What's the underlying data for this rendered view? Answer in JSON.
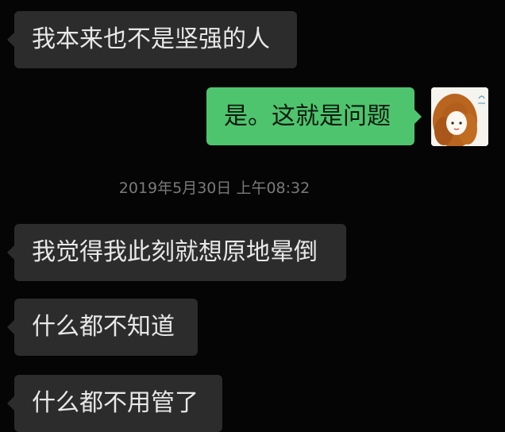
{
  "messages": [
    {
      "direction": "incoming",
      "text": "我本来也不是坚强的人"
    },
    {
      "direction": "outgoing",
      "text": "是。这就是问题"
    },
    {
      "direction": "incoming",
      "text": "我觉得我此刻就想原地晕倒"
    },
    {
      "direction": "incoming",
      "text": "什么都不知道"
    },
    {
      "direction": "incoming",
      "text": "什么都不用管了"
    }
  ],
  "timestamp": "2019年5月30日 上午08:32",
  "colors": {
    "background": "#050505",
    "incoming_bubble": "#2c2c2c",
    "outgoing_bubble": "#4fc46e",
    "timestamp_text": "#7a7a7a"
  },
  "icons": {
    "avatar": "avatar-girl-curly-hair-icon"
  }
}
